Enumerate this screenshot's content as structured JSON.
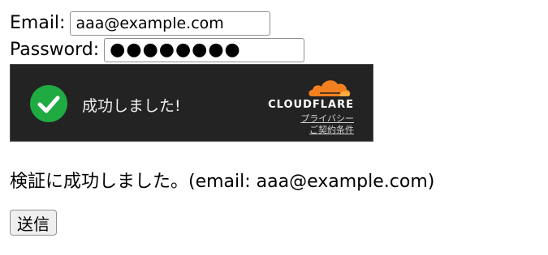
{
  "form": {
    "email_label": "Email:",
    "email_value": "aaa@example.com",
    "password_label": "Password:",
    "password_value": "●●●●●●●●"
  },
  "turnstile": {
    "status_text": "成功しました!",
    "brand": "CLOUDFLARE",
    "privacy_link": "プライバシー",
    "terms_link": "ご契約条件",
    "colors": {
      "background": "#232323",
      "success": "#1faa42",
      "cloud_orange": "#f38020"
    }
  },
  "result_text": "検証に成功しました。(email: aaa@example.com)",
  "submit_label": "送信"
}
